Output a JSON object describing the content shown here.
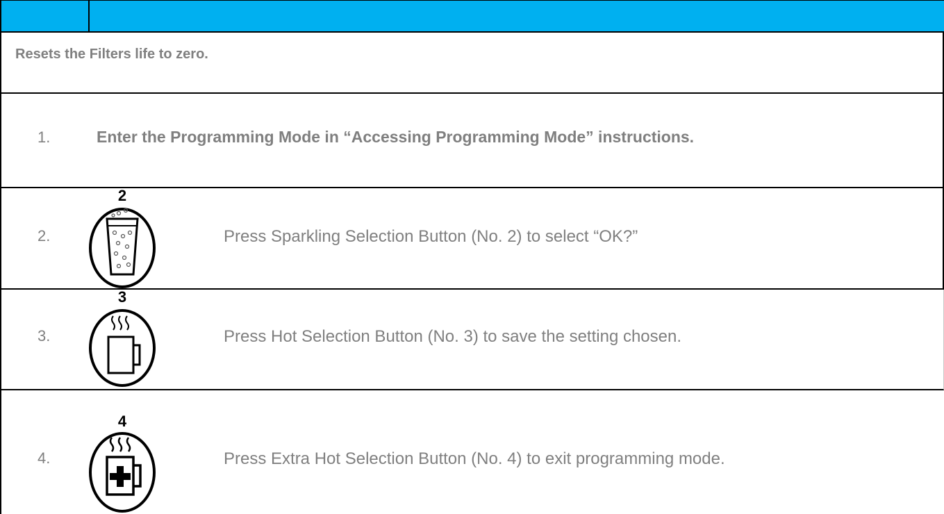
{
  "intro": "Resets the Filters life to zero.",
  "steps": [
    {
      "num": "1.",
      "text": "Enter the Programming Mode in “Accessing Programming Mode” instructions."
    },
    {
      "num": "2.",
      "button": "2",
      "icon": "sparkling-water-glass-icon",
      "text": "Press Sparkling Selection Button (No. 2) to select “OK?”"
    },
    {
      "num": "3.",
      "button": "3",
      "icon": "hot-mug-icon",
      "text": "Press Hot Selection Button (No. 3) to save the setting chosen."
    },
    {
      "num": "4.",
      "button": "4",
      "icon": "extra-hot-mug-icon",
      "text": "Press Extra Hot Selection Button (No. 4) to exit programming mode."
    }
  ],
  "colors": {
    "header": "#00b0f0",
    "text": "#7f7f7f"
  }
}
